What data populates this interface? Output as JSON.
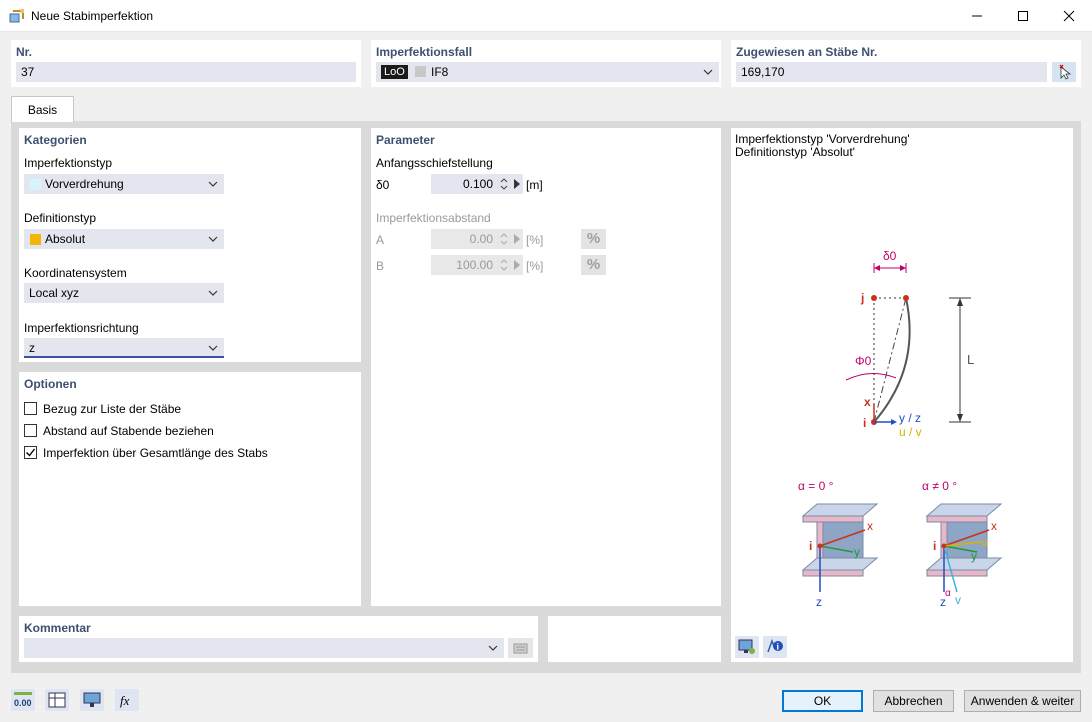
{
  "window": {
    "title": "Neue Stabimperfektion"
  },
  "header": {
    "nr_label": "Nr.",
    "nr_value": "37",
    "imperf_case_label": "Imperfektionsfall",
    "imperf_case_tag": "LoO",
    "imperf_case_value": "IF8",
    "assigned_label": "Zugewiesen an Stäbe Nr.",
    "assigned_value": "169,170"
  },
  "tabs": [
    {
      "label": "Basis"
    }
  ],
  "kategorien": {
    "title": "Kategorien",
    "imperf_type_label": "Imperfektionstyp",
    "imperf_type_value": "Vorverdrehung",
    "imperf_type_color": "#d7f3fb",
    "def_type_label": "Definitionstyp",
    "def_type_value": "Absolut",
    "def_type_color": "#f2b705",
    "coord_label": "Koordinatensystem",
    "coord_value": "Local xyz",
    "dir_label": "Imperfektionsrichtung",
    "dir_value": "z"
  },
  "optionen": {
    "title": "Optionen",
    "items": [
      {
        "label": "Bezug zur Liste der Stäbe",
        "checked": false
      },
      {
        "label": "Abstand auf Stabende beziehen",
        "checked": false
      },
      {
        "label": "Imperfektion über Gesamtlänge des Stabs",
        "checked": true
      }
    ]
  },
  "parameter": {
    "title": "Parameter",
    "initial_label": "Anfangsschiefstellung",
    "delta_symbol": "δ0",
    "delta_value": "0.100",
    "delta_unit": "[m]",
    "distance_label": "Imperfektionsabstand",
    "a_label": "A",
    "a_value": "0.00",
    "a_unit": "[%]",
    "b_label": "B",
    "b_value": "100.00",
    "b_unit": "[%]",
    "pct_label": "%"
  },
  "info": {
    "line1": "Imperfektionstyp 'Vorverdrehung'",
    "line2": "Definitionstyp 'Absolut'",
    "diagram": {
      "delta": "δ0",
      "phi": "Φ0",
      "j": "j",
      "i": "i",
      "x": "x",
      "L": "L",
      "yz": "y / z",
      "uv": "u / v",
      "alpha0": "α = 0 °",
      "alphaNot0": "α ≠ 0 °",
      "z": "z",
      "y": "y",
      "u": "u",
      "v": "v",
      "alpha": "α"
    }
  },
  "kommentar": {
    "title": "Kommentar",
    "value": ""
  },
  "footer": {
    "ok": "OK",
    "cancel": "Abbrechen",
    "apply": "Anwenden & weiter",
    "icon1_text": "0.00",
    "icon4_text": "fx"
  }
}
